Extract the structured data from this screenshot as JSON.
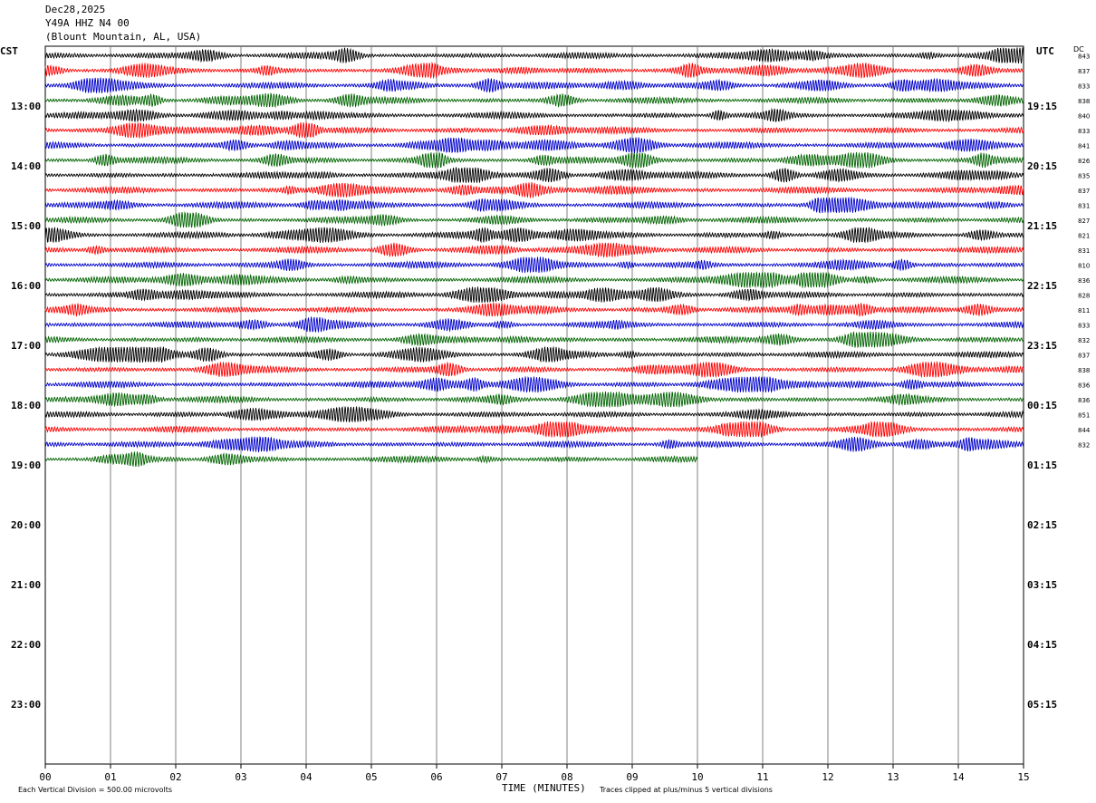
{
  "header": {
    "date": "Dec28,2025",
    "station": "Y49A HHZ N4 00",
    "location": "(Blount Mountain, AL, USA)"
  },
  "left_zone": "CST",
  "right_zone": "UTC",
  "dc_label": "DC",
  "footer": {
    "scale_note": "Each Vertical Division =  500.00 microvolts",
    "xlabel": "TIME (MINUTES)",
    "clip_note": "Traces clipped at plus/minus 5 vertical divisions"
  },
  "chart_data": {
    "type": "line",
    "subtype": "helicorder",
    "xlabel": "TIME (MINUTES)",
    "x_range": [
      0,
      15
    ],
    "x_ticks": [
      "00",
      "01",
      "02",
      "03",
      "04",
      "05",
      "06",
      "07",
      "08",
      "09",
      "10",
      "11",
      "12",
      "13",
      "14",
      "15"
    ],
    "minutes_per_line": 15,
    "total_lines": 48,
    "lines_per_hour": 4,
    "recorded_lines": 28,
    "last_line_end_minute": 10,
    "trace_colors": [
      "#000000",
      "#ff0000",
      "#0000cc",
      "#006400"
    ],
    "left_hour_labels": [
      "13:00",
      "14:00",
      "15:00",
      "16:00",
      "17:00",
      "18:00",
      "19:00",
      "20:00",
      "21:00",
      "22:00",
      "23:00"
    ],
    "right_hour_labels": [
      "19:15",
      "20:15",
      "21:15",
      "22:15",
      "23:15",
      "00:15",
      "01:15",
      "02:15",
      "03:15",
      "04:15",
      "05:15"
    ],
    "dc_offsets": [
      843,
      837,
      833,
      838,
      840,
      833,
      841,
      826,
      835,
      837,
      831,
      827,
      821,
      831,
      810,
      836,
      828,
      811,
      833,
      832,
      837,
      838,
      836,
      836,
      851,
      844,
      832
    ],
    "grid": true
  }
}
